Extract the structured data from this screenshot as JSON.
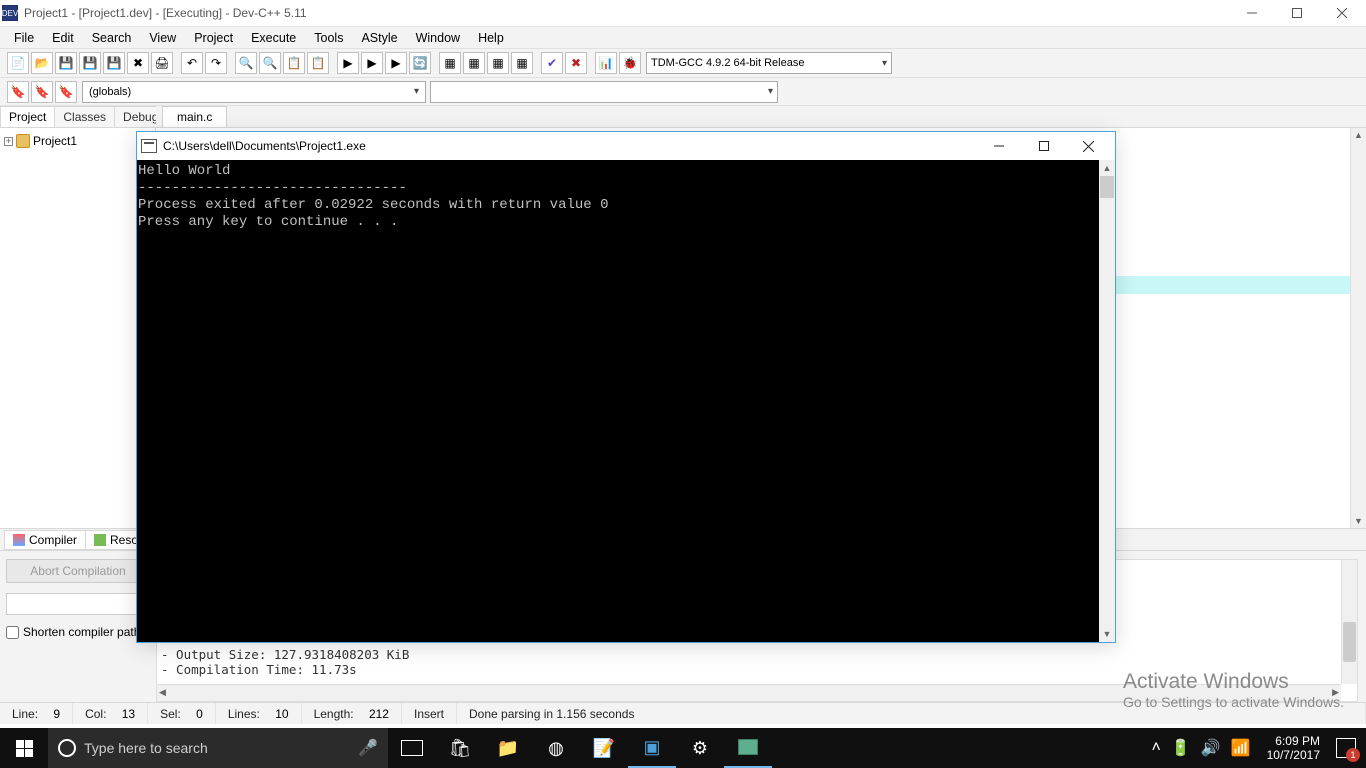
{
  "titlebar": {
    "title": "Project1 - [Project1.dev] - [Executing] - Dev-C++ 5.11"
  },
  "menubar": [
    "File",
    "Edit",
    "Search",
    "View",
    "Project",
    "Execute",
    "Tools",
    "AStyle",
    "Window",
    "Help"
  ],
  "compiler_selector": "TDM-GCC 4.9.2 64-bit Release",
  "globals_selector": "(globals)",
  "left_tabs": [
    "Project",
    "Classes",
    "Debug"
  ],
  "tree": {
    "root": "Project1"
  },
  "file_tabs": [
    "main.c"
  ],
  "bottom_tabs": [
    "Compiler",
    "Reso"
  ],
  "compiler_panel": {
    "abort_btn": "Abort Compilation",
    "shorten_label": "Shorten compiler path",
    "log": "- Output Size: 127.9318408203 KiB\n- Compilation Time: 11.73s"
  },
  "statusbar": {
    "line_label": "Line:",
    "line": "9",
    "col_label": "Col:",
    "col": "13",
    "sel_label": "Sel:",
    "sel": "0",
    "lines_label": "Lines:",
    "lines": "10",
    "length_label": "Length:",
    "length": "212",
    "mode": "Insert",
    "parse": "Done parsing in 1.156 seconds"
  },
  "console": {
    "title": "C:\\Users\\dell\\Documents\\Project1.exe",
    "body": "Hello World\n--------------------------------\nProcess exited after 0.02922 seconds with return value 0\nPress any key to continue . . ."
  },
  "watermark": {
    "line1": "Activate Windows",
    "line2": "Go to Settings to activate Windows."
  },
  "taskbar": {
    "search_placeholder": "Type here to search",
    "time": "6:09 PM",
    "date": "10/7/2017",
    "badge": "1"
  }
}
